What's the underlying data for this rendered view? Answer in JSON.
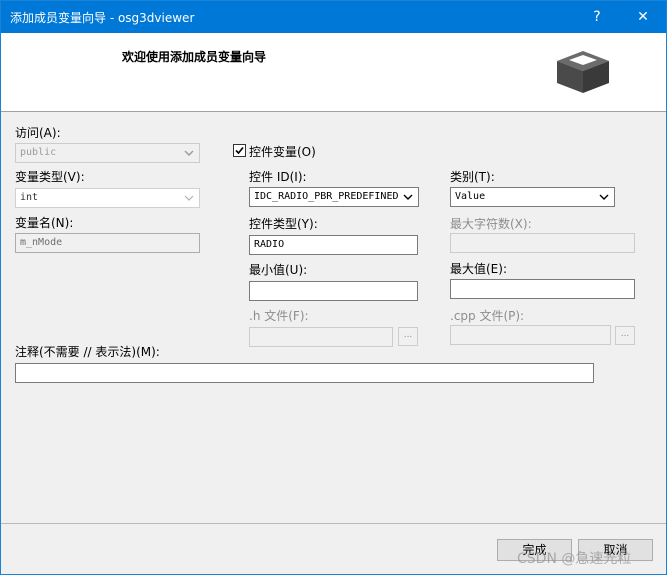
{
  "window": {
    "title": "添加成员变量向导 - osg3dviewer",
    "help_glyph": "?",
    "close_glyph": "✕"
  },
  "header": {
    "title": "欢迎使用添加成员变量向导",
    "icon": "class-box-icon"
  },
  "access": {
    "label": "访问(A):",
    "value": "public"
  },
  "control_var": {
    "label": "控件变量(O)",
    "checked": true
  },
  "var_type": {
    "label": "变量类型(V):",
    "value": "int"
  },
  "control_id": {
    "label": "控件 ID(I):",
    "value": "IDC_RADIO_PBR_PREDEFINED"
  },
  "category": {
    "label": "类别(T):",
    "value": "Value"
  },
  "var_name": {
    "label": "变量名(N):",
    "value": "m_nMode"
  },
  "control_type": {
    "label": "控件类型(Y):",
    "value": "RADIO"
  },
  "max_chars": {
    "label": "最大字符数(X):",
    "value": ""
  },
  "min_value": {
    "label": "最小值(U):",
    "value": ""
  },
  "max_value": {
    "label": "最大值(E):",
    "value": ""
  },
  "h_file": {
    "label": ".h 文件(F):",
    "value": "",
    "browse": "..."
  },
  "cpp_file": {
    "label": ".cpp 文件(P):",
    "value": "",
    "browse": "..."
  },
  "comment": {
    "label": "注释(不需要 // 表示法)(M):",
    "value": ""
  },
  "buttons": {
    "finish": "完成",
    "cancel": "取消"
  },
  "watermark": "CSDN @急速光粒",
  "colors": {
    "titlebar": "#0078d7",
    "window_bg": "#f0f0f0",
    "header_bg": "#ffffff"
  }
}
